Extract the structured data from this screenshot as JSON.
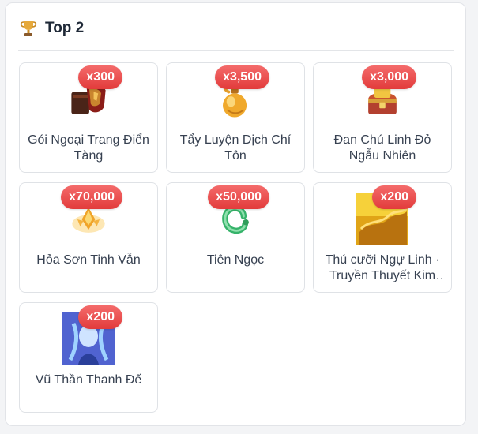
{
  "header": {
    "title": "Top 2",
    "icon": "trophy-icon"
  },
  "items": [
    {
      "badge": "x300",
      "name": "Gói Ngoại Trang Điển Tàng",
      "icon": "armor-chest-icon"
    },
    {
      "badge": "x3,500",
      "name": "Tẩy Luyện Dịch Chí Tôn",
      "icon": "golden-potion-icon"
    },
    {
      "badge": "x3,000",
      "name": "Đan Chú Linh Đỏ Ngẫu Nhiên",
      "icon": "treasure-chest-icon"
    },
    {
      "badge": "x70,000",
      "name": "Hỏa Sơn Tinh Vẫn",
      "icon": "fire-crystal-icon"
    },
    {
      "badge": "x50,000",
      "name": "Tiên Ngọc",
      "icon": "jade-dragon-icon"
    },
    {
      "badge": "x200",
      "name": "Thú cưỡi Ngự Linh · Truyền Thuyết Kim Long",
      "icon": "golden-dragon-mount-icon"
    },
    {
      "badge": "x200",
      "name": "Vũ Thần Thanh Đế",
      "icon": "blue-goddess-icon"
    }
  ]
}
